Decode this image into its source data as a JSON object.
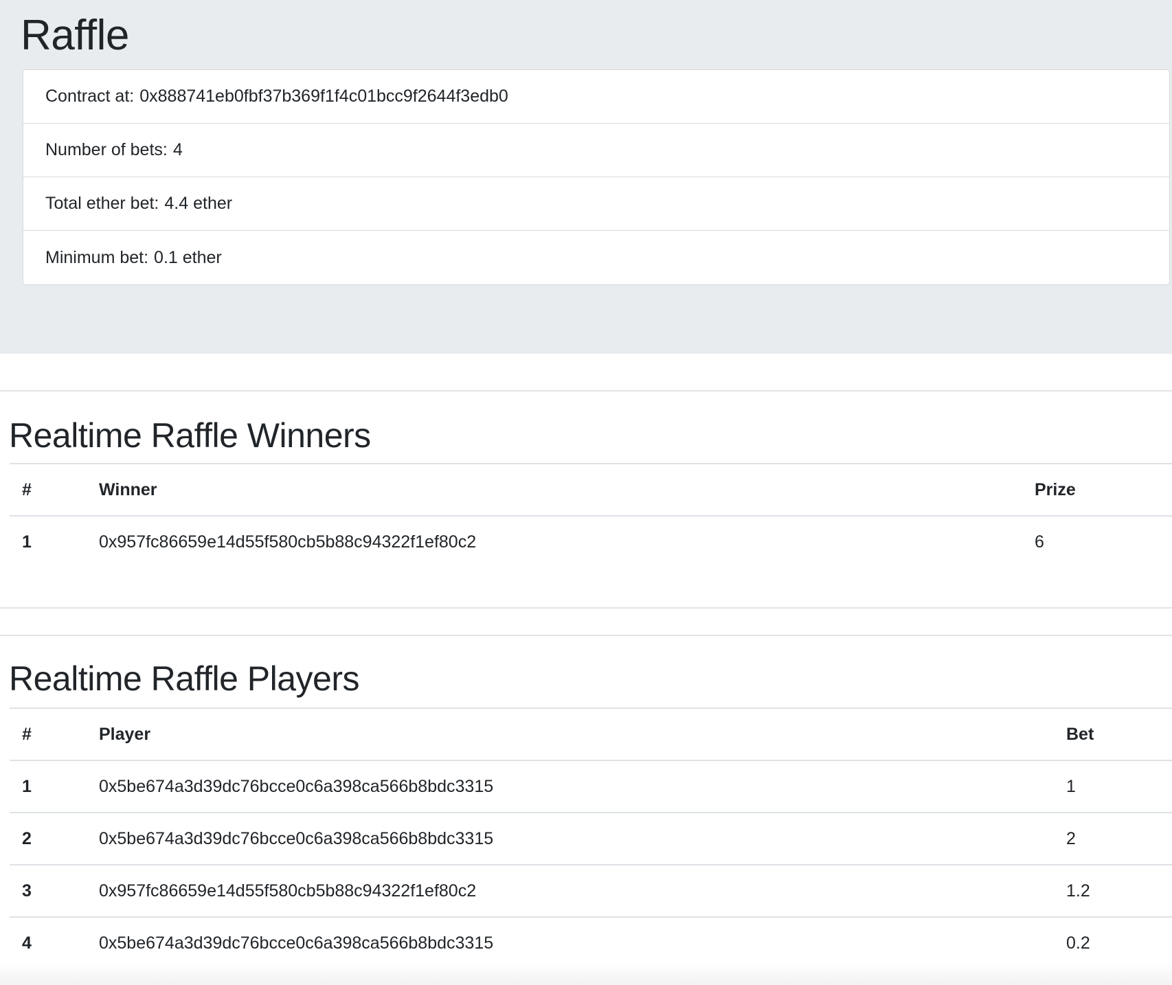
{
  "header": {
    "title": "Raffle"
  },
  "info": {
    "contract_label": "Contract at:",
    "contract_address": "0x888741eb0fbf37b369f1f4c01bcc9f2644f3edb0",
    "bets_label": "Number of bets:",
    "bets_value": "4",
    "total_label": "Total ether bet:",
    "total_value": "4.4 ether",
    "min_label": "Minimum bet:",
    "min_value": "0.1 ether"
  },
  "winners": {
    "title": "Realtime Raffle Winners",
    "columns": [
      "#",
      "Winner",
      "Prize"
    ],
    "rows": [
      {
        "index": "1",
        "address": "0x957fc86659e14d55f580cb5b88c94322f1ef80c2",
        "prize": "6"
      }
    ]
  },
  "players": {
    "title": "Realtime Raffle Players",
    "columns": [
      "#",
      "Player",
      "Bet"
    ],
    "rows": [
      {
        "index": "1",
        "address": "0x5be674a3d39dc76bcce0c6a398ca566b8bdc3315",
        "bet": "1"
      },
      {
        "index": "2",
        "address": "0x5be674a3d39dc76bcce0c6a398ca566b8bdc3315",
        "bet": "2"
      },
      {
        "index": "3",
        "address": "0x957fc86659e14d55f580cb5b88c94322f1ef80c2",
        "bet": "1.2"
      },
      {
        "index": "4",
        "address": "0x5be674a3d39dc76bcce0c6a398ca566b8bdc3315",
        "bet": "0.2"
      }
    ]
  }
}
